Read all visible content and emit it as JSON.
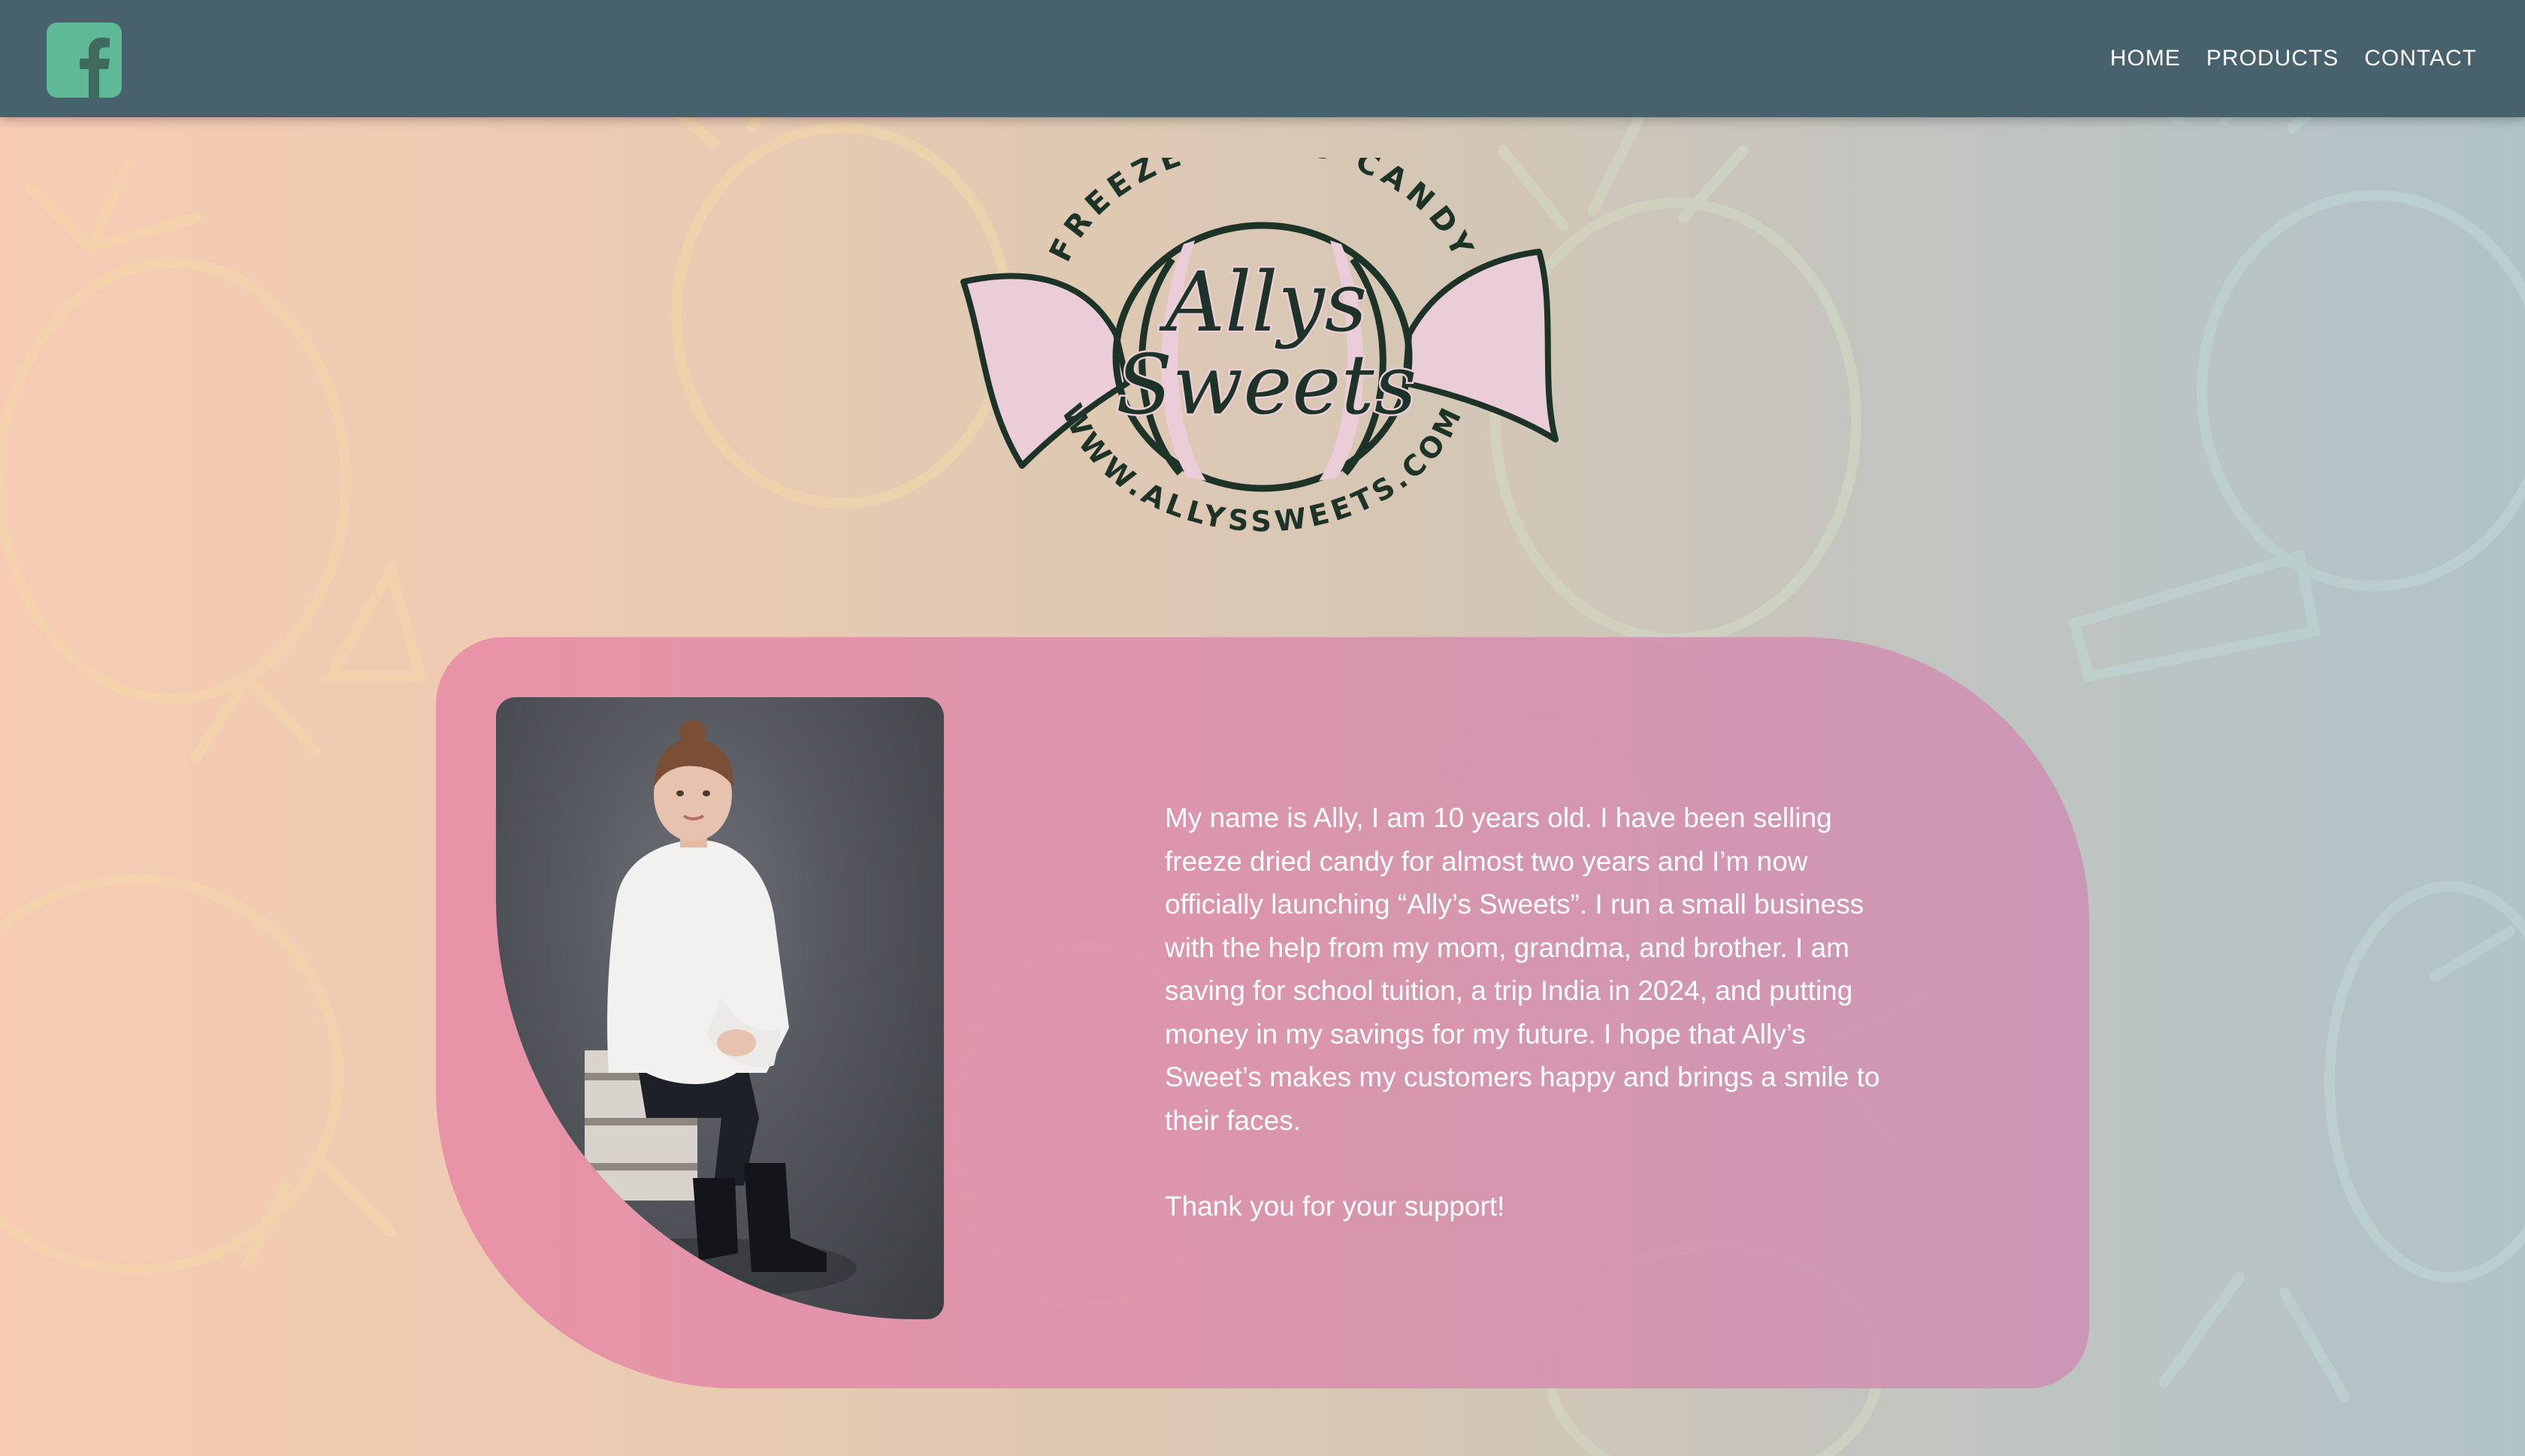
{
  "header": {
    "social_icon": "facebook-icon",
    "nav": [
      {
        "label": "HOME"
      },
      {
        "label": "PRODUCTS"
      },
      {
        "label": "CONTACT"
      }
    ]
  },
  "logo": {
    "top_arc_text": "FREEZE DRIED CANDY",
    "name_line1": "Allys",
    "name_line2": "Sweets",
    "bottom_arc_text": "WWW.ALLYSSWEETS.COM"
  },
  "about": {
    "paragraph": "My name is Ally, I am 10 years old. I have been selling freeze dried candy for almost two years and I’m now officially launching “Ally’s Sweets”. I run a small business with the help from my mom, grandma, and brother. I am saving for school tuition, a trip India in 2024, and putting money in my savings for my future. I hope that Ally’s Sweet’s makes my customers happy and brings a smile to their faces.",
    "thanks": "Thank you for your support!"
  },
  "colors": {
    "header": "#47626c",
    "card": "#e08fa8",
    "logo_ink": "#1d3327",
    "logo_pink": "#ebcdd9",
    "facebook_green": "#5fb996"
  }
}
